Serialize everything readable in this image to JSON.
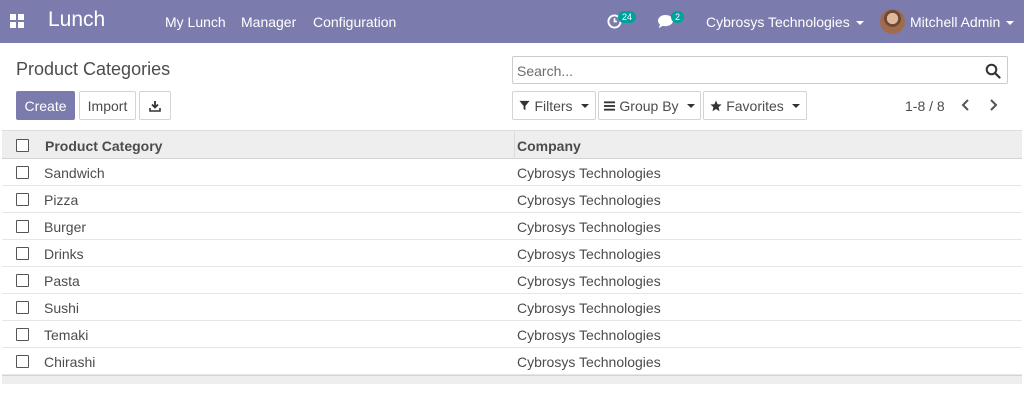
{
  "navbar": {
    "app_name": "Lunch",
    "menu": [
      "My Lunch",
      "Manager",
      "Configuration"
    ],
    "activity_count": "24",
    "message_count": "2",
    "company": "Cybrosys Technologies",
    "user": "Mitchell Admin",
    "bg_color": "#7c7bad"
  },
  "control_panel": {
    "title": "Product Categories",
    "search_placeholder": "Search...",
    "create_label": "Create",
    "import_label": "Import",
    "filters_label": "Filters",
    "groupby_label": "Group By",
    "favorites_label": "Favorites",
    "pager_value": "1-8 / 8"
  },
  "table": {
    "columns": [
      "Product Category",
      "Company"
    ],
    "rows": [
      [
        "Sandwich",
        "Cybrosys Technologies"
      ],
      [
        "Pizza",
        "Cybrosys Technologies"
      ],
      [
        "Burger",
        "Cybrosys Technologies"
      ],
      [
        "Drinks",
        "Cybrosys Technologies"
      ],
      [
        "Pasta",
        "Cybrosys Technologies"
      ],
      [
        "Sushi",
        "Cybrosys Technologies"
      ],
      [
        "Temaki",
        "Cybrosys Technologies"
      ],
      [
        "Chirashi",
        "Cybrosys Technologies"
      ]
    ]
  },
  "icons": {
    "apps": "apps-grid-icon",
    "activity": "clock-icon",
    "messages": "chat-icon",
    "search": "search-icon",
    "download": "download-icon",
    "filter": "filter-icon",
    "groupby": "list-icon",
    "favorites": "star-icon",
    "prev": "chevron-left-icon",
    "next": "chevron-right-icon"
  }
}
